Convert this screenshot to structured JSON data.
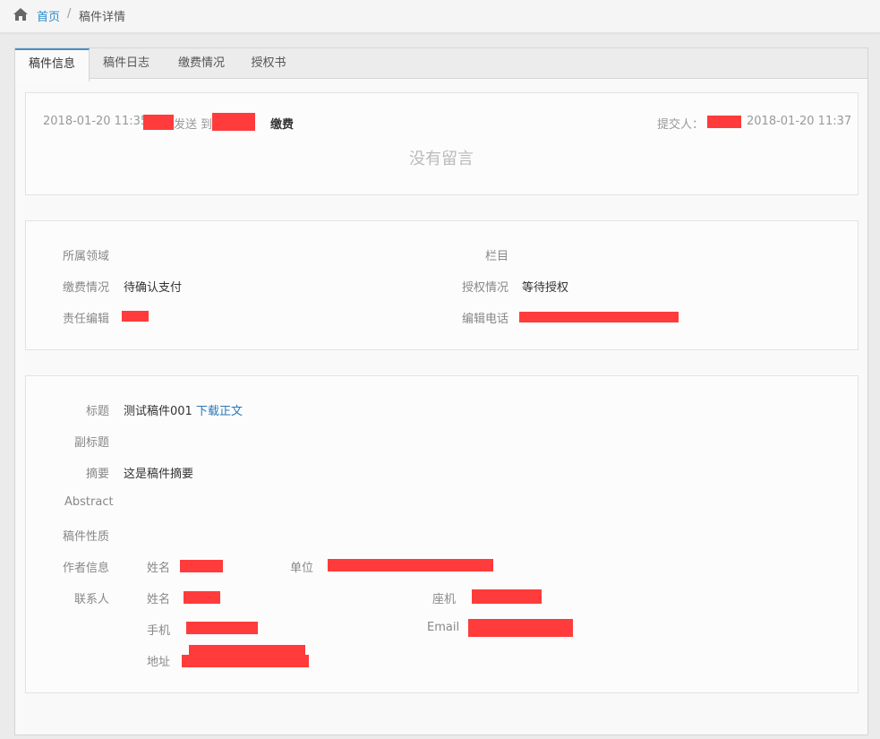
{
  "breadcrumb": {
    "home": "首页",
    "separator": "/",
    "current": "稿件详情"
  },
  "tabs": [
    {
      "label": "稿件信息",
      "active": true
    },
    {
      "label": "稿件日志",
      "active": false
    },
    {
      "label": "缴费情况",
      "active": false
    },
    {
      "label": "授权书",
      "active": false
    }
  ],
  "message": {
    "time": "2018-01-20 11:35",
    "sent_to_text": "发送 到",
    "action": "缴费",
    "submitter_label": "提交人：",
    "submit_time": "2018-01-20 11:37",
    "empty_text": "没有留言"
  },
  "info": {
    "field_label": "所属领域",
    "column_label": "栏目",
    "fee_label": "缴费情况",
    "fee_value": "待确认支付",
    "auth_label": "授权情况",
    "auth_value": "等待授权",
    "editor_label": "责任编辑",
    "editor_phone_label": "编辑电话"
  },
  "manuscript": {
    "title_label": "标题",
    "title_value": "测试稿件001",
    "download_link": "下载正文",
    "subtitle_label": "副标题",
    "summary_label": "摘要",
    "summary_value": "这是稿件摘要",
    "abstract_label": "Abstract",
    "nature_label": "稿件性质",
    "author_label": "作者信息",
    "author_name_label": "姓名",
    "author_unit_label": "单位",
    "contact_label": "联系人",
    "contact_name_label": "姓名",
    "landline_label": "座机",
    "mobile_label": "手机",
    "email_label": "Email",
    "address_label": "地址"
  },
  "colors": {
    "accent": "#2a8bcb",
    "redaction": "#ff3b3b",
    "tab_active_border": "#4a90c8"
  }
}
